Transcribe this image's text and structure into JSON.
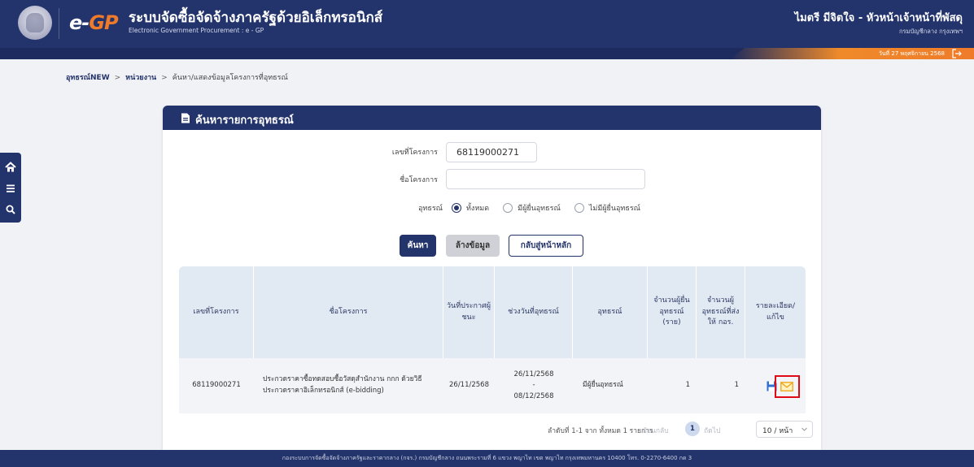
{
  "header": {
    "logo_e": "e-",
    "logo_gp": "GP",
    "title": "ระบบจัดซื้อจัดจ้างภาครัฐด้วยอิเล็กทรอนิกส์",
    "subtitle": "Electronic Government Procurement : e - GP",
    "user_name": "ไมตรี มีจิตใจ - หัวหน้าเจ้าหน้าที่พัสดุ",
    "user_dept": "กรมบัญชีกลาง กรุงเทพฯ",
    "date": "วันที่ 27 พฤศจิกายน 2568",
    "accent_color": "#ef7b2a"
  },
  "breadcrumb": {
    "items": [
      "อุทธรณ์NEW",
      "หน่วยงาน",
      "ค้นหา/แสดงข้อมูลโครงการที่อุทธรณ์"
    ],
    "separator": ">"
  },
  "panel": {
    "title": "ค้นหารายการอุทธรณ์"
  },
  "form": {
    "project_no_label": "เลขที่โครงการ",
    "project_no_value": "68119000271",
    "project_name_label": "ชื่อโครงการ",
    "project_name_value": "",
    "appeal_label": "อุทธรณ์",
    "appeal_options": [
      "ทั้งหมด",
      "มีผู้ยื่นอุทธรณ์",
      "ไม่มีผู้ยื่นอุทธรณ์"
    ],
    "appeal_selected": "ทั้งหมด"
  },
  "buttons": {
    "search": "ค้นหา",
    "clear": "ล้างข้อมูล",
    "home": "กลับสู่หน้าหลัก"
  },
  "table": {
    "headers": {
      "project_no": "เลขที่โครงการ",
      "project_name": "ชื่อโครงการ",
      "announce_date": "วันที่ประกาศผู้ชนะ",
      "appeal_period": "ช่วงวันที่อุทธรณ์",
      "appeal": "อุทธรณ์",
      "appellant_count": "จำนวนผู้ยื่นอุทธรณ์ (ราย)",
      "sent_count": "จำนวนผู้อุทธรณ์ที่ส่งให้ กอร.",
      "detail": "รายละเอียด/แก้ไข"
    },
    "rows": [
      {
        "project_no": "68119000271",
        "project_name": "ประกวดราคาซื้อทดสอบซื้อวัสดุสำนักงาน กกก ด้วยวิธีประกวดราคาอิเล็กทรอนิกส์ (e-bidding)",
        "announce_date": "26/11/2568",
        "appeal_start": "26/11/2568",
        "appeal_dash": "-",
        "appeal_end": "08/12/2568",
        "appeal": "มีผู้ยื่นอุทธรณ์",
        "appellant_count": "1",
        "sent_count": "1"
      }
    ]
  },
  "pager": {
    "info": "ลำดับที่ 1-1 จาก ทั้งหมด 1 รายการ",
    "prev": "ย้อนกลับ",
    "page": "1",
    "next": "ถัดไป",
    "page_size": "10 / หน้า"
  },
  "footer": {
    "text": "กองระบบการจัดซื้อจัดจ้างภาครัฐและราคากลาง (กจร.) กรมบัญชีกลาง ถนนพระรามที่ 6 แขวง พญาไท เขต พญาไท กรุงเทพมหานคร 10400 โทร. 0-2270-6400 กด 3"
  }
}
